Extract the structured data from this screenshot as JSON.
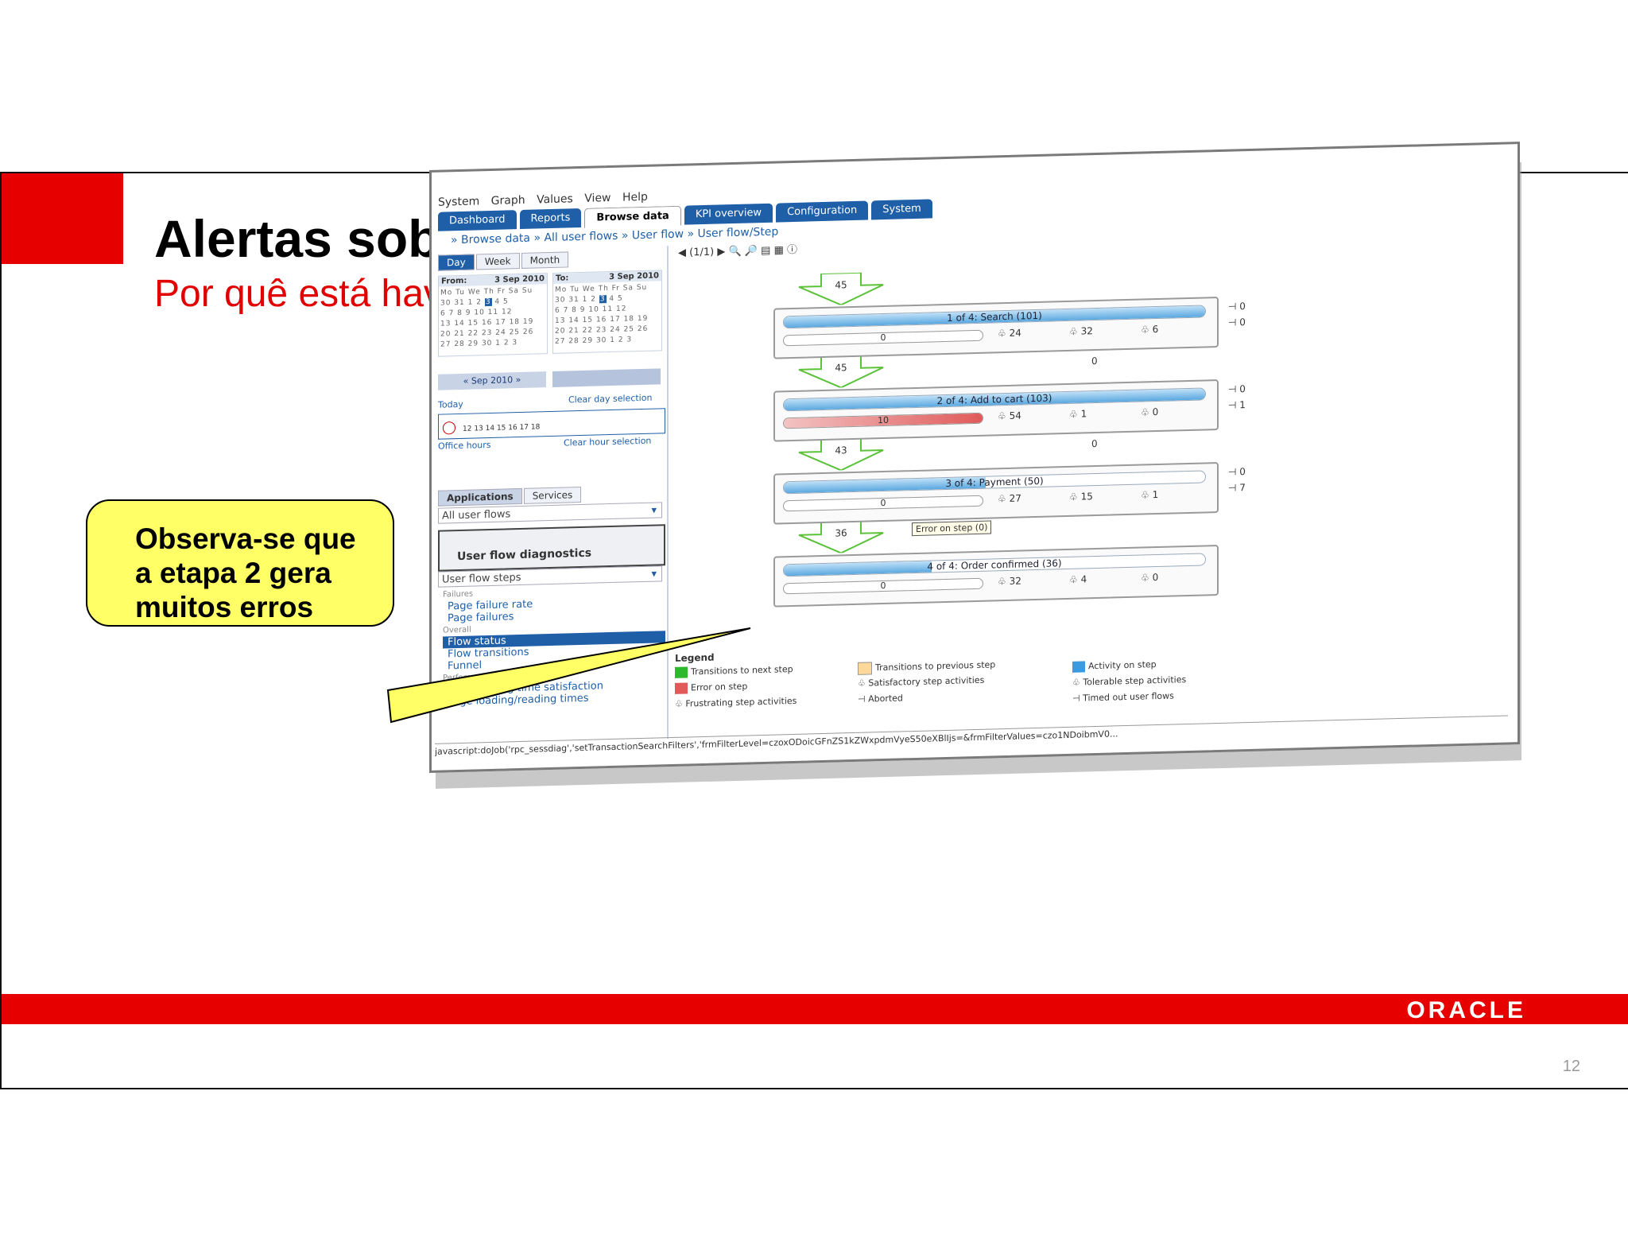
{
  "slide": {
    "title": "Alertas sobre Baixa dos Pedidos",
    "subtitle": "Por quê está havendo uma baixa nos pedidos?",
    "callout": [
      "Observa-se que",
      "a etapa 2 gera",
      "muitos erros"
    ],
    "logo": "ORACLE",
    "page_number": "12",
    "colors": {
      "accent_red": "#e60000",
      "callout_yellow": "#ffff66"
    }
  },
  "app": {
    "menu": [
      "System",
      "Graph",
      "Values",
      "View",
      "Help"
    ],
    "tabs": [
      "Dashboard",
      "Reports",
      "Browse data",
      "KPI overview",
      "Configuration",
      "System"
    ],
    "active_tab": "Browse data",
    "breadcrumb": [
      "» Browse data",
      "» All user flows",
      "» User flow",
      "» User flow/Step"
    ],
    "pager": "(1/1)",
    "period_tabs": [
      "Day",
      "Week",
      "Month"
    ],
    "from_label": "From:",
    "from_date": "3 Sep 2010",
    "to_label": "To:",
    "to_date": "3 Sep 2010",
    "weekdays": "Mo Tu We Th Fr Sa Su",
    "month_nav": "« Sep 2010 »",
    "today": "Today",
    "clear_day": "Clear day selection",
    "office_hours": "Office hours",
    "clear_hour": "Clear hour selection",
    "hours_row2": "12 13 14 15 16 17 18",
    "app_tabs": [
      "Applications",
      "Services"
    ],
    "user_flows_select": "All user flows",
    "diag_header": "User flow diagnostics",
    "steps_select": "User flow steps",
    "sections": {
      "failures": "Failures",
      "overall": "Overall",
      "performance": "Performance"
    },
    "links": {
      "page_failure_rate": "Page failure rate",
      "page_failures": "Page failures",
      "flow_status": "Flow status",
      "flow_transitions": "Flow transitions",
      "funnel": "Funnel",
      "page_loading_sat": "Page loading time satisfaction",
      "page_loading_times": "Page loading/reading times"
    },
    "flow": {
      "arrows": [
        "45",
        "45",
        "43",
        "36"
      ],
      "steps": [
        {
          "label": "1 of 4: Search (101)",
          "fill": 1.0,
          "errors": "0",
          "error_fill": 0,
          "satisfactory": "24",
          "tolerable": "32",
          "frustrating": "6",
          "aborted": "0",
          "timed_out": "0"
        },
        {
          "label": "2 of 4: Add to cart (103)",
          "fill": 1.0,
          "errors": "10",
          "error_fill": 1.0,
          "satisfactory": "54",
          "tolerable": "1",
          "frustrating": "0",
          "aborted": "0",
          "timed_out": "1"
        },
        {
          "label": "3 of 4: Payment (50)",
          "fill": 0.48,
          "errors": "0",
          "error_fill": 0,
          "satisfactory": "27",
          "tolerable": "15",
          "frustrating": "1",
          "aborted": "0",
          "timed_out": "7"
        },
        {
          "label": "4 of 4: Order confirmed (36)",
          "fill": 0.35,
          "errors": "0",
          "error_fill": 0,
          "satisfactory": "32",
          "tolerable": "4",
          "frustrating": "0"
        }
      ],
      "back_transitions": [
        "0",
        "0"
      ],
      "tooltip": "Error on step (0)"
    },
    "legend": {
      "title": "Legend",
      "next": "Transitions to next step",
      "error": "Error on step",
      "frustrating": "Frustrating step activities",
      "previous": "Transitions to previous step",
      "satisfactory": "Satisfactory step activities",
      "aborted": "Aborted",
      "activity": "Activity on step",
      "tolerable": "Tolerable step activities",
      "timed_out": "Timed out user flows"
    },
    "statusbar": "javascript:doJob('rpc_sessdiag','setTransactionSearchFilters','frmFilterLevel=czoxODoicGFnZS1kZWxpdmVyeS50eXBlIjs=&frmFilterValues=czo1NDoibmV0..."
  }
}
